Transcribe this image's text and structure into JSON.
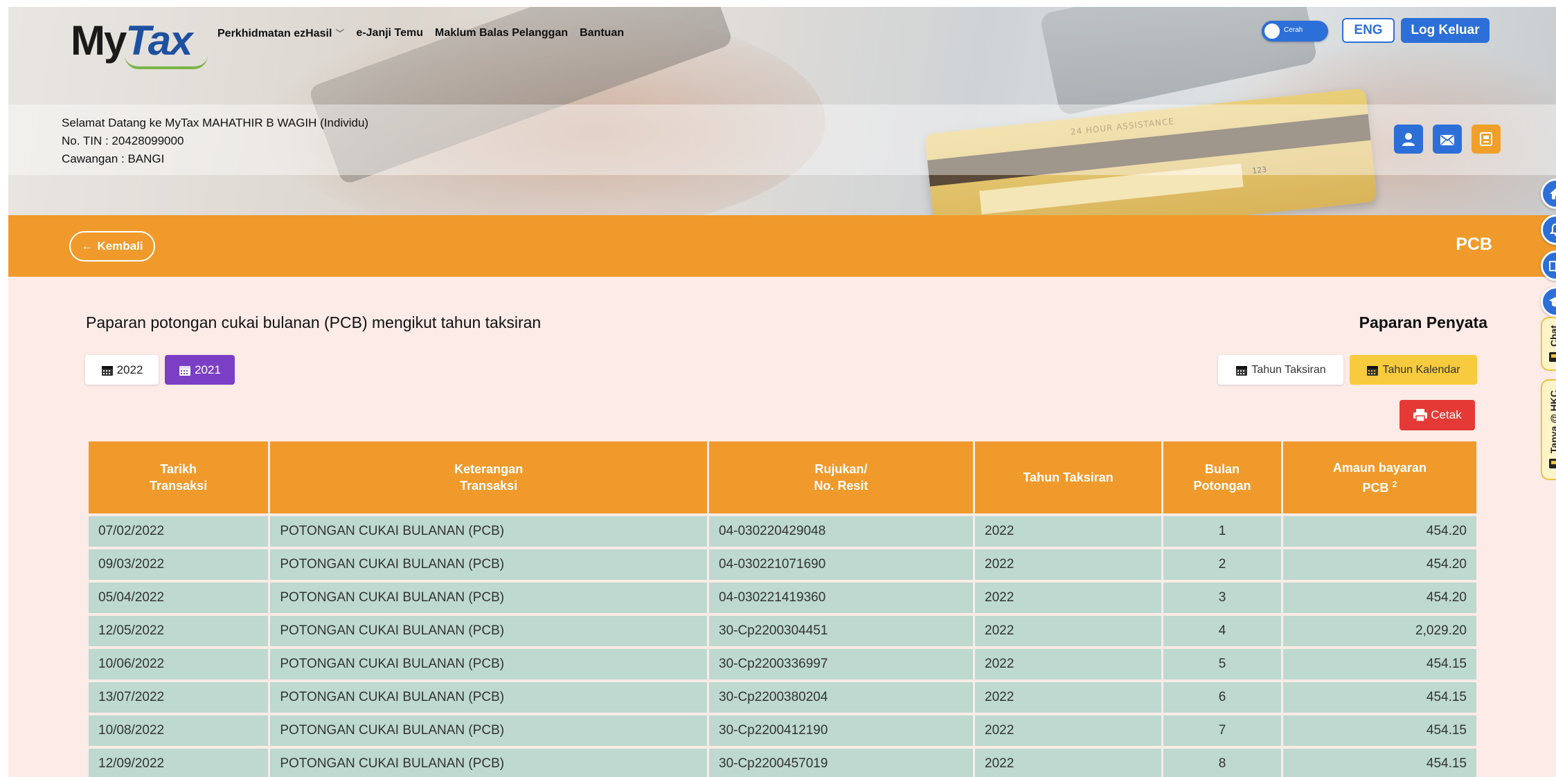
{
  "header": {
    "logo": {
      "my": "My",
      "tax": "Tax"
    },
    "nav": [
      {
        "label": "Perkhidmatan ezHasil",
        "has_dropdown": true
      },
      {
        "label": "e-Janji Temu",
        "has_dropdown": false
      },
      {
        "label": "Maklum Balas Pelanggan",
        "has_dropdown": false
      },
      {
        "label": "Bantuan",
        "has_dropdown": false
      }
    ],
    "theme_toggle_label": "Cerah",
    "lang_button": "ENG",
    "logout_button": "Log Keluar"
  },
  "card_art": {
    "assist": "24 HOUR ASSISTANCE",
    "cvv": "123"
  },
  "welcome": {
    "line1": "Selamat Datang ke MyTax MAHATHIR B WAGIH (Individu)",
    "line2": "No. TIN : 20428099000",
    "line3": "Cawangan : BANGI"
  },
  "bar": {
    "back_label": "Kembali",
    "title": "PCB"
  },
  "content": {
    "heading": "Paparan potongan cukai bulanan (PCB) mengikut tahun taksiran",
    "statement_link": "Paparan Penyata",
    "years": [
      {
        "label": "2022",
        "active": false
      },
      {
        "label": "2021",
        "active": true
      }
    ],
    "view_taksiran": "Tahun Taksiran",
    "view_kalendar": "Tahun Kalendar",
    "print_label": "Cetak"
  },
  "table": {
    "headers": [
      {
        "l1": "Tarikh",
        "l2": "Transaksi"
      },
      {
        "l1": "Keterangan",
        "l2": "Transaksi"
      },
      {
        "l1": "Rujukan/",
        "l2": "No. Resit"
      },
      {
        "l1": "Tahun Taksiran",
        "l2": ""
      },
      {
        "l1": "Bulan",
        "l2": "Potongan"
      },
      {
        "l1": "Amaun bayaran",
        "l2": "PCB",
        "sup": "2"
      }
    ],
    "rows": [
      {
        "date": "07/02/2022",
        "desc": "POTONGAN CUKAI BULANAN (PCB)",
        "ref": "04-030220429048",
        "year": "2022",
        "month": "1",
        "amount": "454.20"
      },
      {
        "date": "09/03/2022",
        "desc": "POTONGAN CUKAI BULANAN (PCB)",
        "ref": "04-030221071690",
        "year": "2022",
        "month": "2",
        "amount": "454.20"
      },
      {
        "date": "05/04/2022",
        "desc": "POTONGAN CUKAI BULANAN (PCB)",
        "ref": "04-030221419360",
        "year": "2022",
        "month": "3",
        "amount": "454.20"
      },
      {
        "date": "12/05/2022",
        "desc": "POTONGAN CUKAI BULANAN (PCB)",
        "ref": "30-Cp2200304451",
        "year": "2022",
        "month": "4",
        "amount": "2,029.20"
      },
      {
        "date": "10/06/2022",
        "desc": "POTONGAN CUKAI BULANAN (PCB)",
        "ref": "30-Cp2200336997",
        "year": "2022",
        "month": "5",
        "amount": "454.15"
      },
      {
        "date": "13/07/2022",
        "desc": "POTONGAN CUKAI BULANAN (PCB)",
        "ref": "30-Cp2200380204",
        "year": "2022",
        "month": "6",
        "amount": "454.15"
      },
      {
        "date": "10/08/2022",
        "desc": "POTONGAN CUKAI BULANAN (PCB)",
        "ref": "30-Cp2200412190",
        "year": "2022",
        "month": "7",
        "amount": "454.15"
      },
      {
        "date": "12/09/2022",
        "desc": "POTONGAN CUKAI BULANAN (PCB)",
        "ref": "30-Cp2200457019",
        "year": "2022",
        "month": "8",
        "amount": "454.15"
      }
    ]
  },
  "rail": {
    "chat_label": "Chat",
    "hkc_label": "Tanya @ HKC"
  },
  "colors": {
    "brand_blue": "#2c6fd8",
    "brand_orange": "#f09a2b",
    "row_bg": "#bdd9d0",
    "page_bg": "#fcebe7",
    "active_year": "#7a3fc4",
    "print_red": "#e53935",
    "calendar_yellow": "#f7cb3d"
  },
  "icons": [
    "chevron-down-icon",
    "arrow-left-icon",
    "calendar-icon",
    "printer-icon",
    "user-icon",
    "mail-icon",
    "document-icon",
    "home-icon",
    "bell-icon",
    "book-icon",
    "graduation-cap-icon",
    "chat-icon"
  ]
}
